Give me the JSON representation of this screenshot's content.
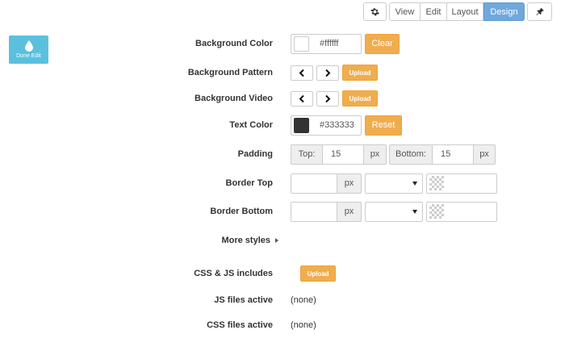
{
  "toolbar": {
    "gear_icon": "gear-icon",
    "tabs": [
      {
        "label": "View"
      },
      {
        "label": "Edit"
      },
      {
        "label": "Layout"
      },
      {
        "label": "Design",
        "active": true
      }
    ],
    "pin_icon": "pin-icon",
    "active_color": "#6fa8dc"
  },
  "done_edit": {
    "label": "Done Edit",
    "icon": "drop-icon",
    "color": "#5bc0de"
  },
  "form": {
    "background_color": {
      "label": "Background Color",
      "value": "#ffffff",
      "swatch": "#ffffff",
      "button": "Clear"
    },
    "background_pattern": {
      "label": "Background Pattern",
      "button": "Upload"
    },
    "background_video": {
      "label": "Background Video",
      "button": "Upload"
    },
    "text_color": {
      "label": "Text Color",
      "value": "#333333",
      "swatch": "#333333",
      "button": "Reset"
    },
    "padding": {
      "label": "Padding",
      "top_label": "Top:",
      "top_value": "15",
      "top_unit": "px",
      "bottom_label": "Bottom:",
      "bottom_value": "15",
      "bottom_unit": "px"
    },
    "border_top": {
      "label": "Border Top",
      "unit": "px",
      "style_value": "",
      "color_value": ""
    },
    "border_bottom": {
      "label": "Border Bottom",
      "unit": "px",
      "style_value": "",
      "color_value": ""
    },
    "more_styles": {
      "label": "More styles"
    },
    "css_js": {
      "label": "CSS & JS includes",
      "button": "Upload"
    },
    "js_files": {
      "label": "JS files active",
      "value": "(none)"
    },
    "css_files": {
      "label": "CSS files active",
      "value": "(none)"
    }
  },
  "colors": {
    "accent_orange": "#f0ad4e"
  }
}
